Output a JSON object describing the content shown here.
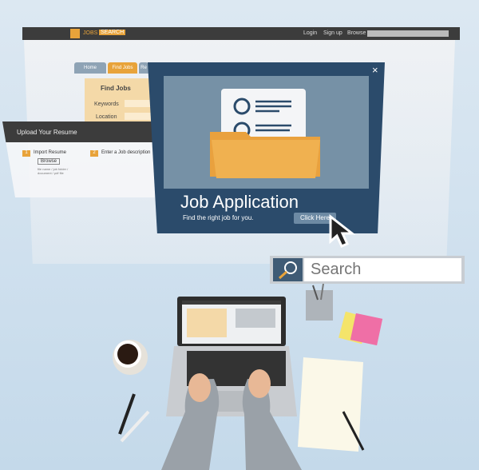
{
  "site": {
    "logo_left": "JOBS",
    "logo_right": "SEARCH",
    "nav": [
      "Login",
      "Sign up",
      "Browse"
    ]
  },
  "tabs": [
    "Home",
    "Find Jobs",
    "Re"
  ],
  "find_jobs": {
    "title": "Find Jobs",
    "fields": [
      "Keywords",
      "Location"
    ]
  },
  "upload": {
    "title": "Upload Your Resume",
    "step1_num": "1",
    "step1": "Import Resume",
    "browse": "Browse",
    "hint": "file name / job folder / document / pdf file",
    "step2_num": "2",
    "step2": "Enter a Job description"
  },
  "modal": {
    "title": "Job Application",
    "subtitle": "Find the right job for you.",
    "button": "Click Here",
    "close": "×"
  },
  "search": {
    "placeholder": "Search"
  },
  "colors": {
    "modal_blue": "#2b4b6b",
    "accent_orange": "#e8a33a",
    "folder": "#eeac4a"
  }
}
